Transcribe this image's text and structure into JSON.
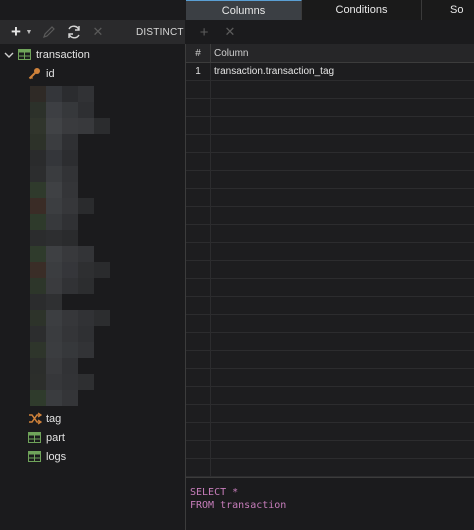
{
  "tabs": [
    {
      "label": "Columns",
      "active": true
    },
    {
      "label": "Conditions",
      "active": false
    },
    {
      "label": "So",
      "active": false
    }
  ],
  "toolbar": {
    "add_icon": "plus-icon",
    "edit_icon": "pencil-icon",
    "refresh_icon": "refresh-icon",
    "delete_icon": "close-icon",
    "distinct_label": "DISTINCT"
  },
  "tree": {
    "root": {
      "label": "transaction",
      "icon": "table-icon",
      "expanded": true
    },
    "children": [
      {
        "label": "id",
        "icon": "key-icon"
      },
      {
        "label": "tag",
        "icon": "shuffle-icon"
      },
      {
        "label": "part",
        "icon": "table-icon"
      },
      {
        "label": "logs",
        "icon": "table-icon"
      }
    ]
  },
  "grid": {
    "headers": {
      "num": "#",
      "column": "Column"
    },
    "rows": [
      {
        "num": "1",
        "column": "transaction.transaction_tag"
      }
    ]
  },
  "sql": {
    "line1": "SELECT *",
    "line2": "FROM transaction"
  },
  "colors": {
    "accent": "#5a9fd4",
    "sql_keyword": "#c77dbb",
    "table_icon": "#6fa35a",
    "key_icon": "#d0823a"
  }
}
